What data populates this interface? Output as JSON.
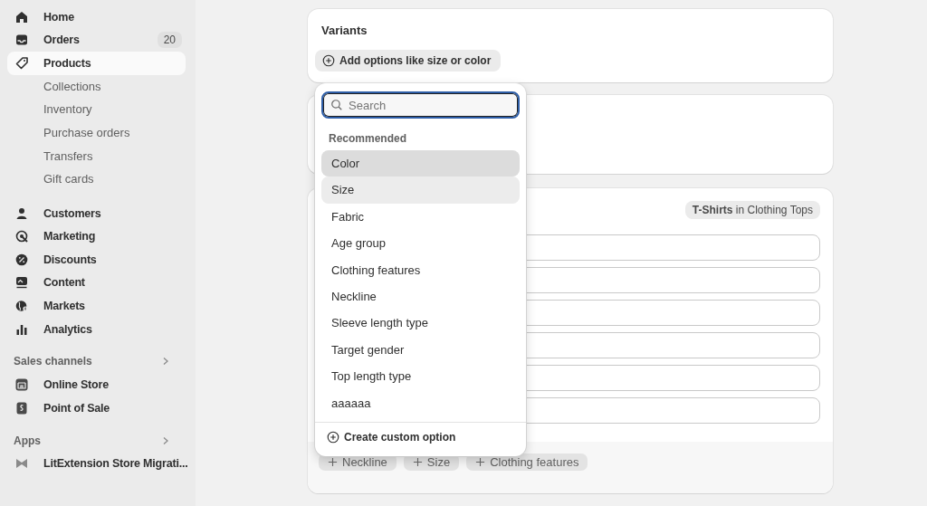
{
  "sidebar": {
    "groups": [
      {
        "items": [
          {
            "label": "Home",
            "selected": false
          },
          {
            "label": "Orders",
            "badge": "20",
            "selected": false
          },
          {
            "label": "Products",
            "selected": true,
            "children": [
              {
                "label": "Collections"
              },
              {
                "label": "Inventory"
              },
              {
                "label": "Purchase orders"
              },
              {
                "label": "Transfers"
              },
              {
                "label": "Gift cards"
              }
            ]
          }
        ]
      },
      {
        "items": [
          {
            "label": "Customers",
            "selected": false
          },
          {
            "label": "Marketing",
            "selected": false
          },
          {
            "label": "Discounts",
            "selected": false
          },
          {
            "label": "Content",
            "selected": false
          },
          {
            "label": "Markets",
            "selected": false
          },
          {
            "label": "Analytics",
            "selected": false
          }
        ]
      },
      {
        "heading": "Sales channels",
        "items": [
          {
            "label": "Online Store",
            "selected": false
          },
          {
            "label": "Point of Sale",
            "selected": false
          }
        ]
      },
      {
        "heading": "Apps",
        "items": [
          {
            "label": "LitExtension Store Migrati...",
            "selected": false
          }
        ]
      }
    ]
  },
  "variants_card": {
    "title": "Variants",
    "add_button": "Add options like size or color"
  },
  "category_card": {
    "badge": "**T-Shirts** in Clothing Tops",
    "suggestions": [
      "Neckline",
      "Size",
      "Clothing features"
    ]
  },
  "dropdown": {
    "search": {
      "placeholder": "Search"
    },
    "section": "Recommended",
    "options": [
      {
        "label": "Color",
        "selected": true,
        "hovered": false
      },
      {
        "label": "Size",
        "selected": false,
        "hovered": true
      },
      {
        "label": "Fabric",
        "selected": false,
        "hovered": false
      },
      {
        "label": "Age group",
        "selected": false,
        "hovered": false
      },
      {
        "label": "Clothing features",
        "selected": false,
        "hovered": false
      },
      {
        "label": "Neckline",
        "selected": false,
        "hovered": false
      },
      {
        "label": "Sleeve length type",
        "selected": false,
        "hovered": false
      },
      {
        "label": "Target gender",
        "selected": false,
        "hovered": false
      },
      {
        "label": "Top length type",
        "selected": false,
        "hovered": false
      },
      {
        "label": "aaaaaa",
        "selected": false,
        "hovered": false
      }
    ],
    "footer_action": "Create custom option"
  }
}
